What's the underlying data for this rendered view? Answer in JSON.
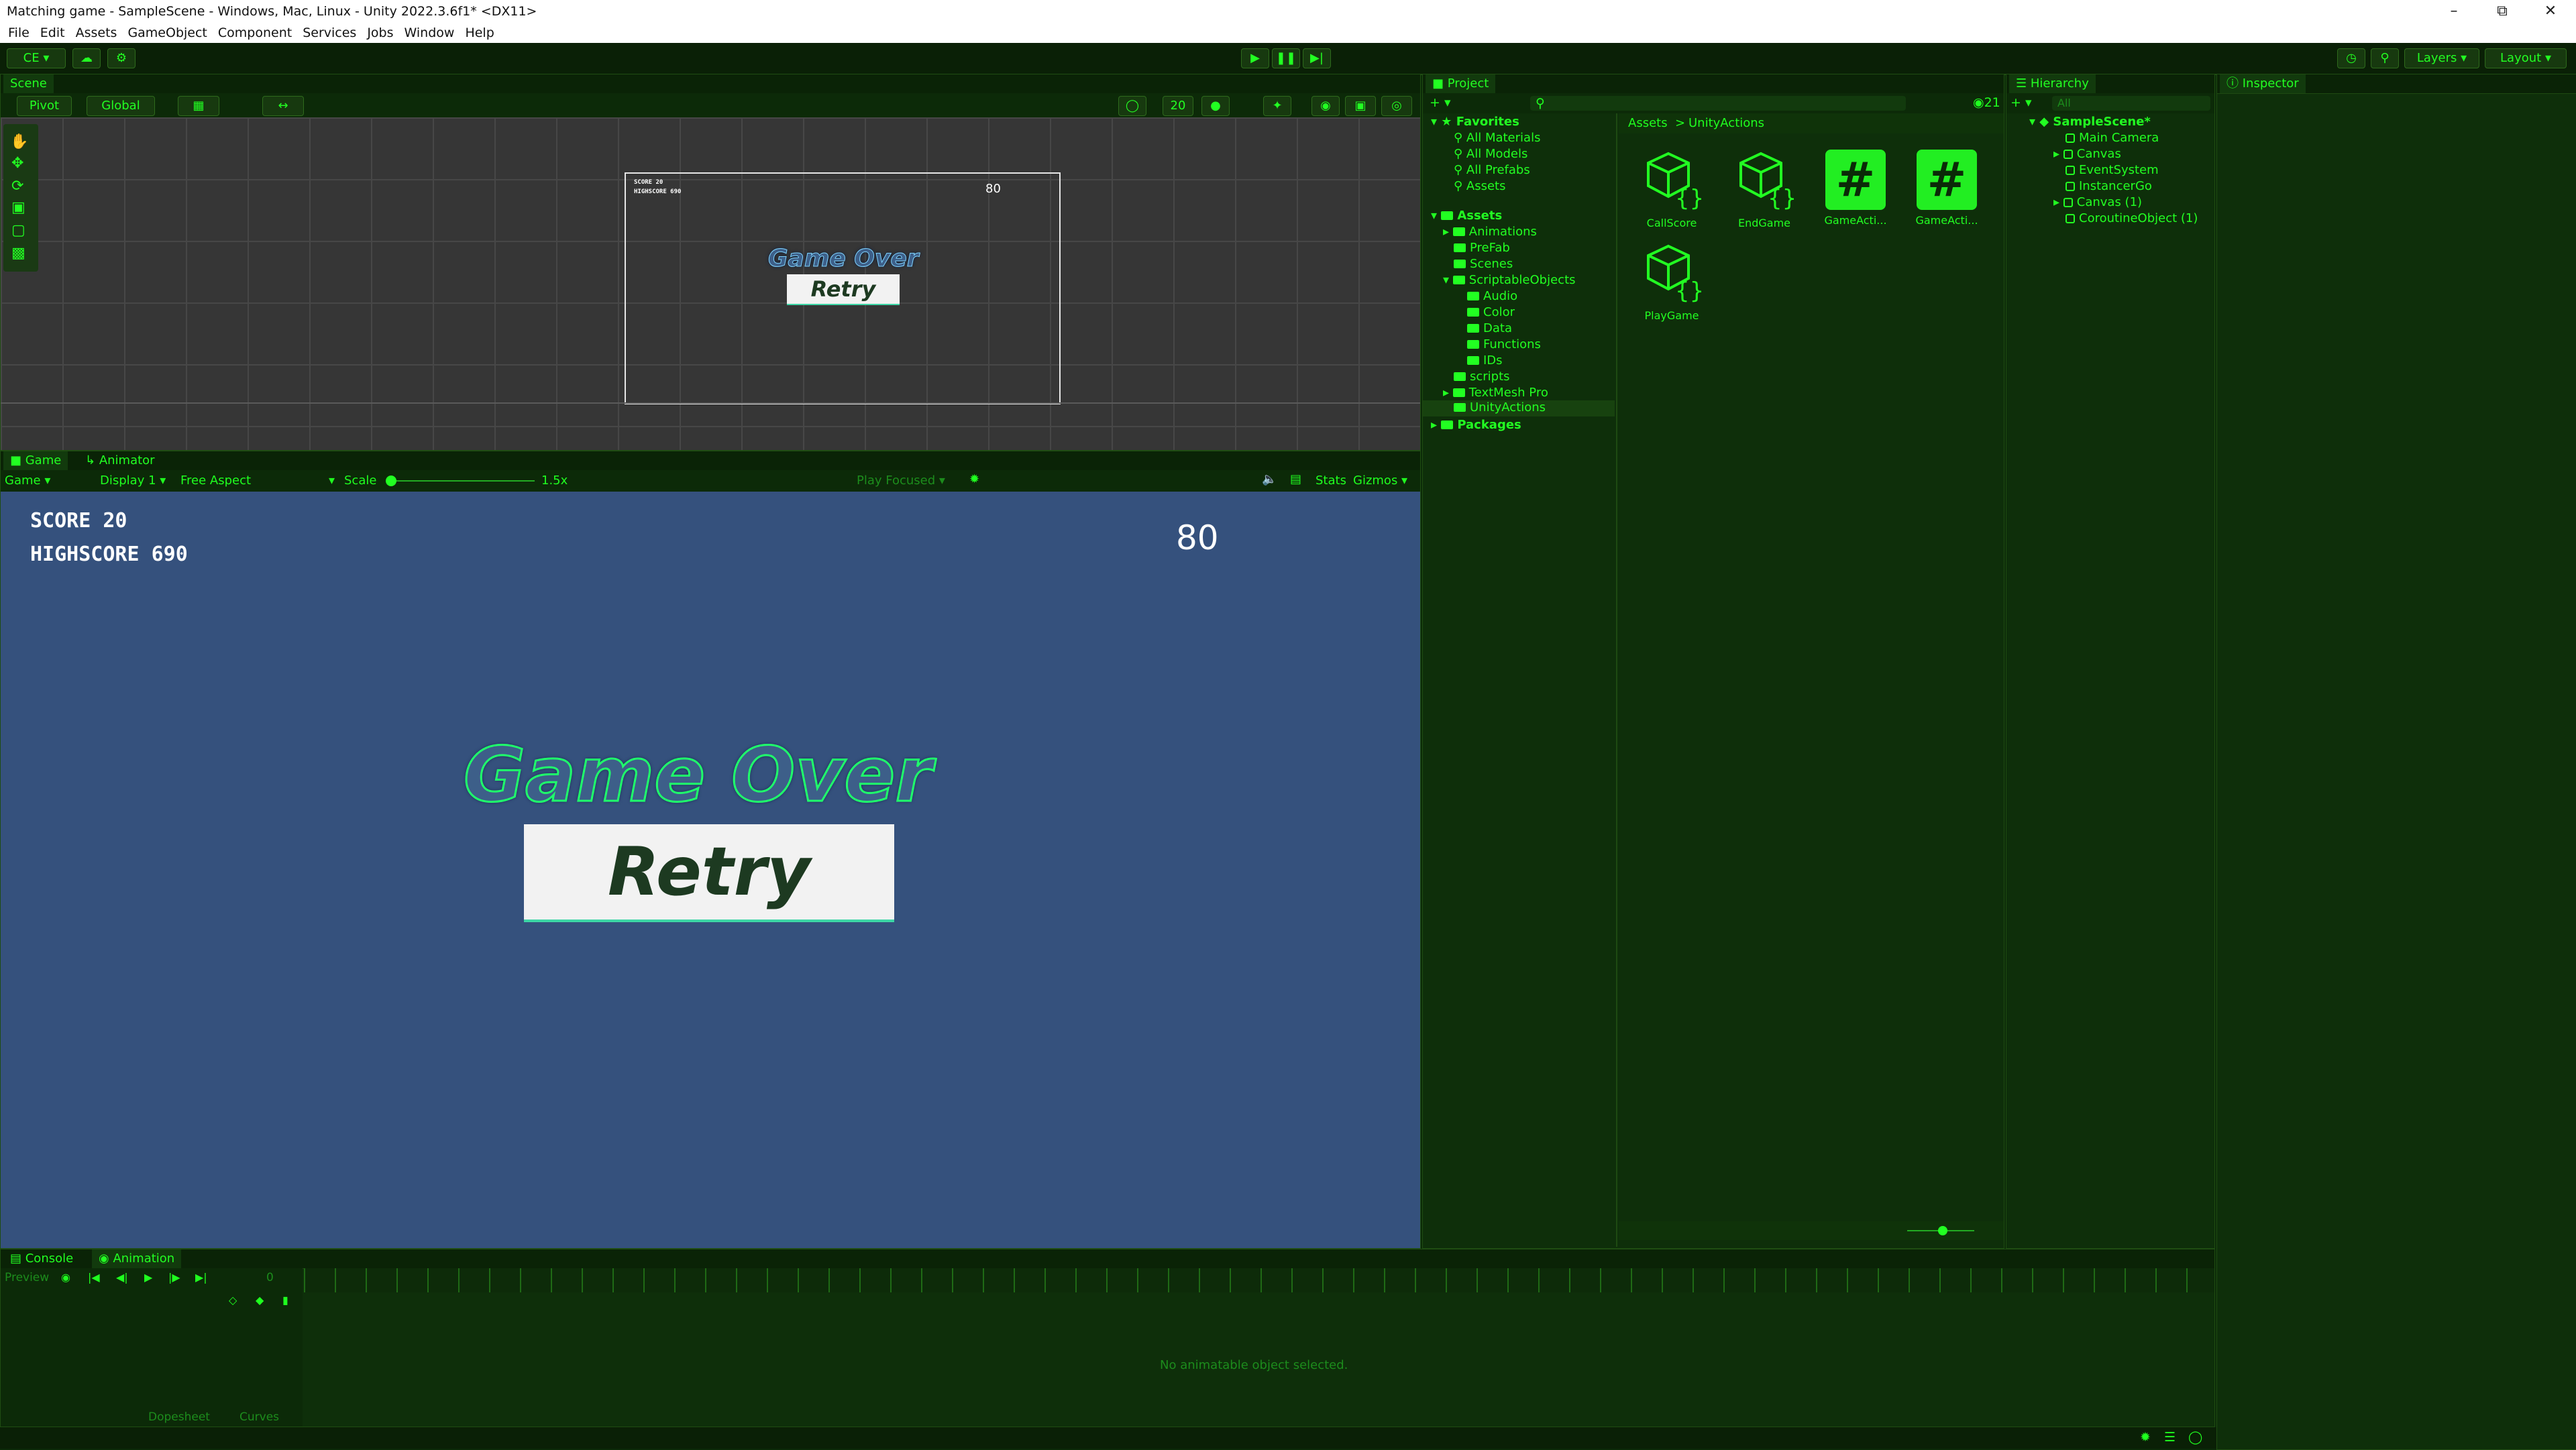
{
  "window": {
    "title": "Matching game - SampleScene - Windows, Mac, Linux - Unity 2022.3.6f1* <DX11>"
  },
  "menu": [
    "File",
    "Edit",
    "Assets",
    "GameObject",
    "Component",
    "Services",
    "Jobs",
    "Window",
    "Help"
  ],
  "toolbar": {
    "account": "CE",
    "layers": "Layers",
    "layout": "Layout"
  },
  "scene": {
    "tab": "Scene",
    "pivot": "Pivot",
    "global": "Global",
    "count": "20",
    "score_small": "SCORE 20",
    "highscore_small": "HIGHSCORE 690",
    "number_small": "80",
    "gameover_small": "Game Over",
    "retry_small": "Retry"
  },
  "game": {
    "tab_game": "Game",
    "tab_animator": "Animator",
    "display_mode": "Game",
    "display": "Display 1",
    "aspect": "Free Aspect",
    "scale_label": "Scale",
    "scale_value": "1.5x",
    "play_focused": "Play Focused",
    "stats": "Stats",
    "gizmos": "Gizmos",
    "score": "SCORE 20",
    "highscore": "HIGHSCORE 690",
    "number": "80",
    "gameover": "Game Over",
    "retry": "Retry"
  },
  "project": {
    "tab": "Project",
    "count": "21",
    "favorites_label": "Favorites",
    "favorites": [
      "All Materials",
      "All Models",
      "All Prefabs",
      "Assets"
    ],
    "assets_label": "Assets",
    "folders": [
      "Animations",
      "PreFab",
      "Scenes",
      "ScriptableObjects",
      "scripts",
      "TextMesh Pro",
      "UnityActions"
    ],
    "scriptable_children": [
      "Audio",
      "Color",
      "Data",
      "Functions",
      "IDs"
    ],
    "packages": "Packages",
    "breadcrumb_root": "Assets",
    "breadcrumb_current": "UnityActions",
    "assets": [
      "CallScore",
      "EndGame",
      "GameActi...",
      "GameActi...",
      "PlayGame"
    ]
  },
  "hierarchy": {
    "tab": "Hierarchy",
    "search_placeholder": "All",
    "scene": "SampleScene*",
    "items": [
      "Main Camera",
      "Canvas",
      "EventSystem",
      "InstancerGo",
      "Canvas (1)",
      "CoroutineObject (1)"
    ]
  },
  "inspector": {
    "tab": "Inspector"
  },
  "bottom": {
    "tab_console": "Console",
    "tab_animation": "Animation",
    "preview": "Preview",
    "frame": "0",
    "empty_message": "No animatable object selected.",
    "dopesheet": "Dopesheet",
    "curves": "Curves"
  },
  "colors": {
    "accent": "#22ff22",
    "panel": "#0e2f0a",
    "game_bg": "#35517d",
    "scene_grid": "#363636"
  }
}
